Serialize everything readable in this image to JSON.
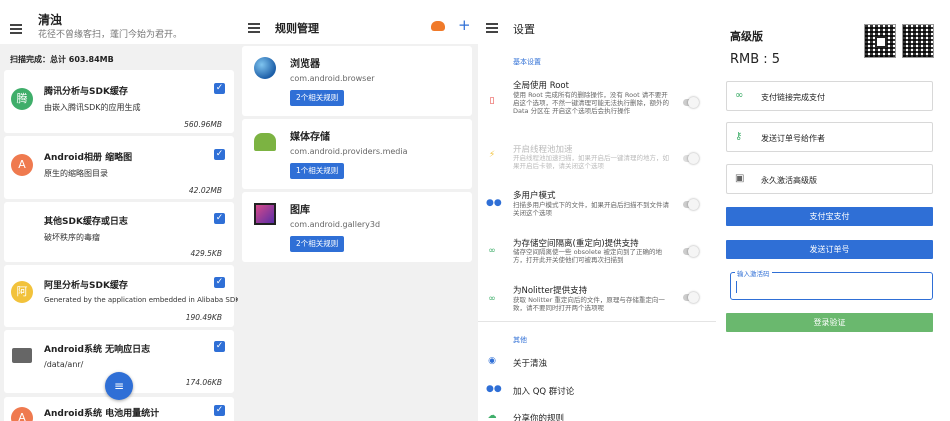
{
  "cleaner": {
    "title": "清浊",
    "subtitle": "花径不曾缘客扫，蓬门今始为君开。",
    "scan_result": "扫描完成：总计 603.84MB",
    "items": [
      {
        "title": "腾讯分析与SDK缓存",
        "desc": "由嵌入腾讯SDK的应用生成",
        "size": "560.96MB",
        "avatar": "腾",
        "color": "#3fae6a"
      },
      {
        "title": "Android相册 缩略图",
        "desc": "原生的缩略图目录",
        "size": "42.02MB",
        "avatar": "A",
        "color": "#ef7a4f"
      },
      {
        "title": "其他SDK缓存或日志",
        "desc": "破坏秩序的毒瘤",
        "size": "429.5KB",
        "avatar": "",
        "color": "#ffffff"
      },
      {
        "title": "阿里分析与SDK缓存",
        "desc": "Generated by the application embedded in Alibaba SDK",
        "size": "190.49KB",
        "avatar": "阿",
        "color": "#f2c23b"
      },
      {
        "title": "Android系统 无响应日志",
        "desc": "/data/anr/",
        "size": "174.06KB",
        "avatar": "",
        "color": "#666666"
      },
      {
        "title": "Android系统 电池用量统计",
        "desc": "",
        "size": "",
        "avatar": "A",
        "color": "#ef7a4f"
      }
    ],
    "check_glyph": "✓",
    "fab_icon": "sweep-icon"
  },
  "rules": {
    "title": "规则管理",
    "add_icon": "+",
    "items": [
      {
        "name": "浏览器",
        "package": "com.android.browser",
        "button": "2个相关规则",
        "icon": "globe-icon"
      },
      {
        "name": "媒体存储",
        "package": "com.android.providers.media",
        "button": "1个相关规则",
        "icon": "android-icon"
      },
      {
        "name": "图库",
        "package": "com.android.gallery3d",
        "button": "2个相关规则",
        "icon": "gallery-icon"
      }
    ]
  },
  "settings": {
    "title": "设置",
    "section_basic": "基本设置",
    "items": [
      {
        "title": "全局使用 Root",
        "desc": "使用 Root 完成所有的删除操作，没有 Root 请不要开启这个选项，不然一键清理可能无法执行删除，额外的 Data 分区在 开启这个选项后会执行操作",
        "icon_color": "#e53935",
        "icon": "phone-icon",
        "disabled": false
      },
      {
        "title": "开启线程池加速",
        "desc": "开启线程池加速扫描，如果开启后一键清理的地方，如果开启后卡顿，请关闭这个选项",
        "icon_color": "#f2c23b",
        "icon": "bolt-icon",
        "disabled": true
      },
      {
        "title": "多用户模式",
        "desc": "扫描多用户模式下的文件，如果开启后扫描不到文件请关闭这个选项",
        "icon_color": "#2f6fd6",
        "icon": "users-icon",
        "disabled": false
      },
      {
        "title": "为存储空间隔离(重定向)提供支持",
        "desc": "储存空间隔离使一些 obsolete 被定向到了正确的地方，打开此开关使他们可被再次扫描到",
        "icon_color": "#3fae6a",
        "icon": "link-icon",
        "disabled": false
      },
      {
        "title": "为Nolitter提供支持",
        "desc": "获取 Nolitter 重定向后的文件，原理与存储重定向一致，请不要同时打开两个选项呢",
        "icon_color": "#3fae6a",
        "icon": "link-icon",
        "disabled": false
      }
    ],
    "section_other": "其他",
    "others": [
      {
        "label": "关于清浊",
        "icon": "info-icon",
        "icon_color": "#2f6fd6"
      },
      {
        "label": "加入 QQ 群讨论",
        "icon": "group-icon",
        "icon_color": "#2f6fd6"
      },
      {
        "label": "分享你的规则",
        "icon": "share-icon",
        "icon_color": "#3fae6a"
      }
    ]
  },
  "premium": {
    "title": "高级版",
    "price": "RMB : 5",
    "options": [
      {
        "label": "支付链接完成支付",
        "icon": "link-icon"
      },
      {
        "label": "发送订单号给作者",
        "icon": "key-icon"
      },
      {
        "label": "永久激活高级版",
        "icon": "gift-icon"
      }
    ],
    "alipay_button": "支付宝支付",
    "send_order_button": "发送订单号",
    "code_label": "输入激活码",
    "verify_button": "登录验证",
    "colors": {
      "primary": "#2f6fd6",
      "verify": "#6ab86e"
    }
  }
}
